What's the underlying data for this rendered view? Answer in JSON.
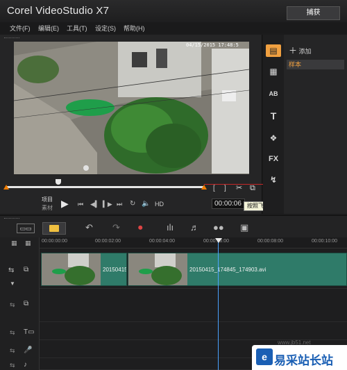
{
  "app": {
    "title": "Corel VideoStudio X7",
    "tab_capture": "捕获"
  },
  "menu": [
    "文件(F)",
    "编辑(E)",
    "工具(T)",
    "设定(S)",
    "帮助(H)"
  ],
  "video": {
    "timestamp": "04/15/2015 17:48:5"
  },
  "player": {
    "mode_project": "项目",
    "mode_clip": "素材",
    "timecode": "00:00:06",
    "hd_label": "HD",
    "tooltip": "按照飞梭栏的位置分割素材 (Ctrl+I)"
  },
  "side_icons": [
    "media-icon",
    "instant-project-icon",
    "title-ab-icon",
    "text-t-icon",
    "graphics-icon",
    "fx-icon",
    "path-icon"
  ],
  "library": {
    "add_label": "添加",
    "item": "样本"
  },
  "ruler": [
    "00:00:00:00",
    "00:00:02:00",
    "00:00:04:00",
    "00:00:06:00",
    "00:00:08:00",
    "00:00:10:00"
  ],
  "clips": [
    {
      "name": "20150415_"
    },
    {
      "name": "20150415_174845_174903.avi"
    }
  ],
  "watermark": {
    "site": "易采站长站",
    "faint": "www.jb51.net"
  }
}
